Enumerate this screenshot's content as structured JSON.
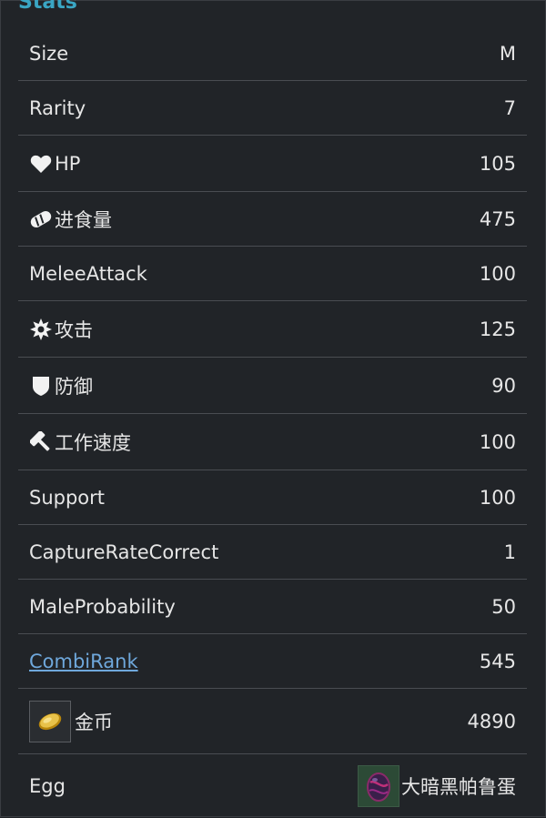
{
  "section": {
    "title": "Stats"
  },
  "rows": [
    {
      "label": "Size",
      "value": "M"
    },
    {
      "label": "Rarity",
      "value": "7"
    },
    {
      "label": "HP",
      "value": "105",
      "icon": "heart-icon"
    },
    {
      "label": "进食量",
      "value": "475",
      "icon": "bread-icon"
    },
    {
      "label": "MeleeAttack",
      "value": "100"
    },
    {
      "label": "攻击",
      "value": "125",
      "icon": "burst-icon"
    },
    {
      "label": "防御",
      "value": "90",
      "icon": "shield-icon"
    },
    {
      "label": "工作速度",
      "value": "100",
      "icon": "hammer-icon"
    },
    {
      "label": "Support",
      "value": "100"
    },
    {
      "label": "CaptureRateCorrect",
      "value": "1"
    },
    {
      "label": "MaleProbability",
      "value": "50"
    },
    {
      "label": "CombiRank",
      "value": "545",
      "link": true
    },
    {
      "label": "金币",
      "value": "4890",
      "icon": "gold-coin-icon"
    },
    {
      "label": "Egg",
      "value": "大暗黑帕鲁蛋",
      "icon": "dark-egg-icon"
    }
  ]
}
